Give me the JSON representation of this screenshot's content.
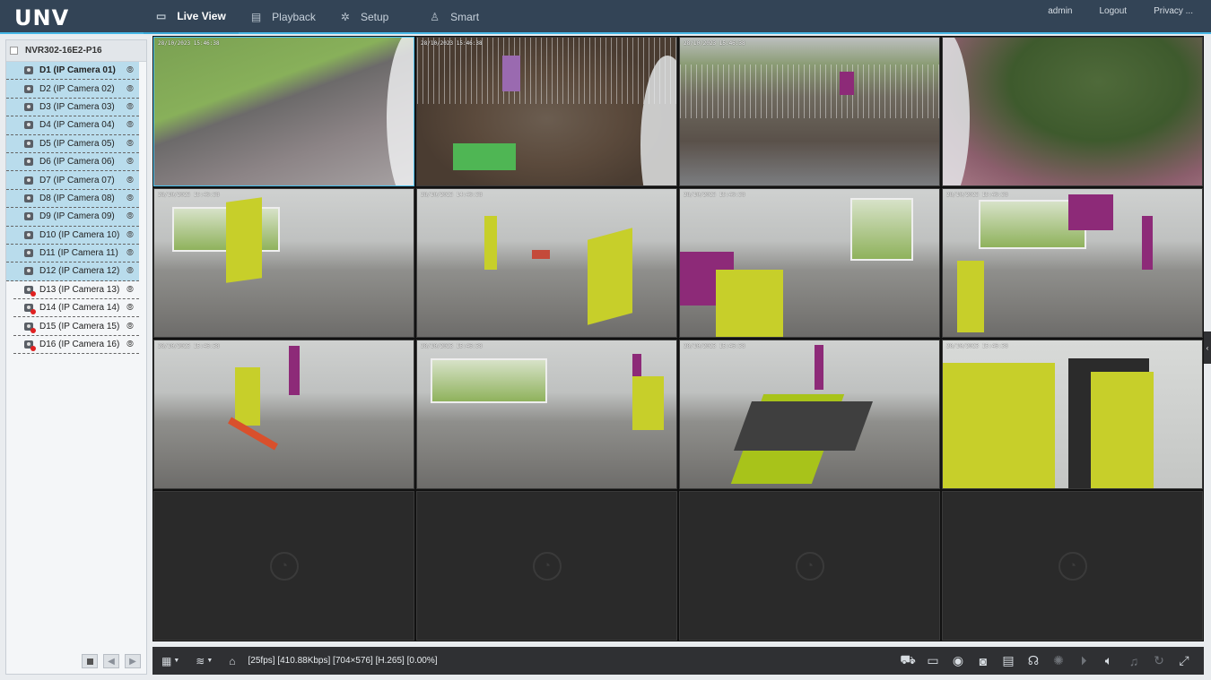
{
  "brand": {
    "logo": "UNV"
  },
  "nav": {
    "live_view": "Live View",
    "playback": "Playback",
    "setup": "Setup",
    "smart": "Smart"
  },
  "user": {
    "name": "admin",
    "logout": "Logout",
    "privacy": "Privacy ..."
  },
  "device": {
    "name": "NVR302-16E2-P16"
  },
  "cameras": [
    {
      "label": "D1 (IP Camera 01)",
      "online": true
    },
    {
      "label": "D2 (IP Camera 02)",
      "online": true
    },
    {
      "label": "D3 (IP Camera 03)",
      "online": true
    },
    {
      "label": "D4 (IP Camera 04)",
      "online": true
    },
    {
      "label": "D5 (IP Camera 05)",
      "online": true
    },
    {
      "label": "D6 (IP Camera 06)",
      "online": true
    },
    {
      "label": "D7 (IP Camera 07)",
      "online": true
    },
    {
      "label": "D8 (IP Camera 08)",
      "online": true
    },
    {
      "label": "D9 (IP Camera 09)",
      "online": true
    },
    {
      "label": "D10 (IP Camera 10)",
      "online": true
    },
    {
      "label": "D11 (IP Camera 11)",
      "online": true
    },
    {
      "label": "D12 (IP Camera 12)",
      "online": true
    },
    {
      "label": "D13 (IP Camera 13)",
      "online": false
    },
    {
      "label": "D14 (IP Camera 14)",
      "online": false
    },
    {
      "label": "D15 (IP Camera 15)",
      "online": false
    },
    {
      "label": "D16 (IP Camera 16)",
      "online": false
    }
  ],
  "tiles": {
    "t1": "28/10/2023 15:46:38",
    "t2": "28/10/2023 15:46:38",
    "t3": "28/10/2023 15:46:38",
    "t5": "28/10/2023 15:46:38",
    "t6": "28/10/2023 14:46:38",
    "t7": "28/10/2023 15:46:38",
    "t8": "28/10/2023 15:46:38",
    "t9": "28/10/2023 15:46:38",
    "t10": "28/10/2023 15:46:38",
    "t11": "28/10/2023 15:46:38",
    "t12": "28/10/2023 15:46:38"
  },
  "toolbar": {
    "stream_info": "[25fps] [410.88Kbps] [704×576] [H.265] [0.00%]",
    "icons_right": [
      "ptz-icon",
      "osd-icon",
      "zoom-icon",
      "snapshot-icon",
      "record-icon",
      "audio-talk-icon",
      "brightness-icon",
      "forward-icon",
      "volume-icon",
      "microphone-icon",
      "refresh-icon",
      "fullscreen-icon"
    ]
  }
}
